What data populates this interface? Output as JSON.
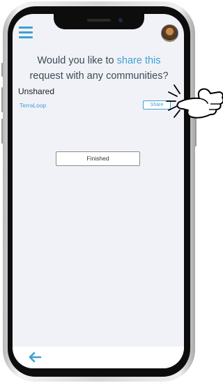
{
  "screen": {
    "question_part1": "Would you like to ",
    "question_highlight": "share this",
    "question_part2": "request with any communities?"
  },
  "section": {
    "label": "Unshared"
  },
  "communities": [
    {
      "name": "TerraLoop",
      "action_label": "Share"
    }
  ],
  "actions": {
    "finished_label": "Finished"
  },
  "icons": {
    "menu": "hamburger-menu-icon",
    "avatar": "user-avatar",
    "back": "left-arrow-icon",
    "pointer": "tapping-hand-icon"
  },
  "colors": {
    "accent": "#3fa0d4",
    "screen_bg": "#f1f2f7"
  }
}
